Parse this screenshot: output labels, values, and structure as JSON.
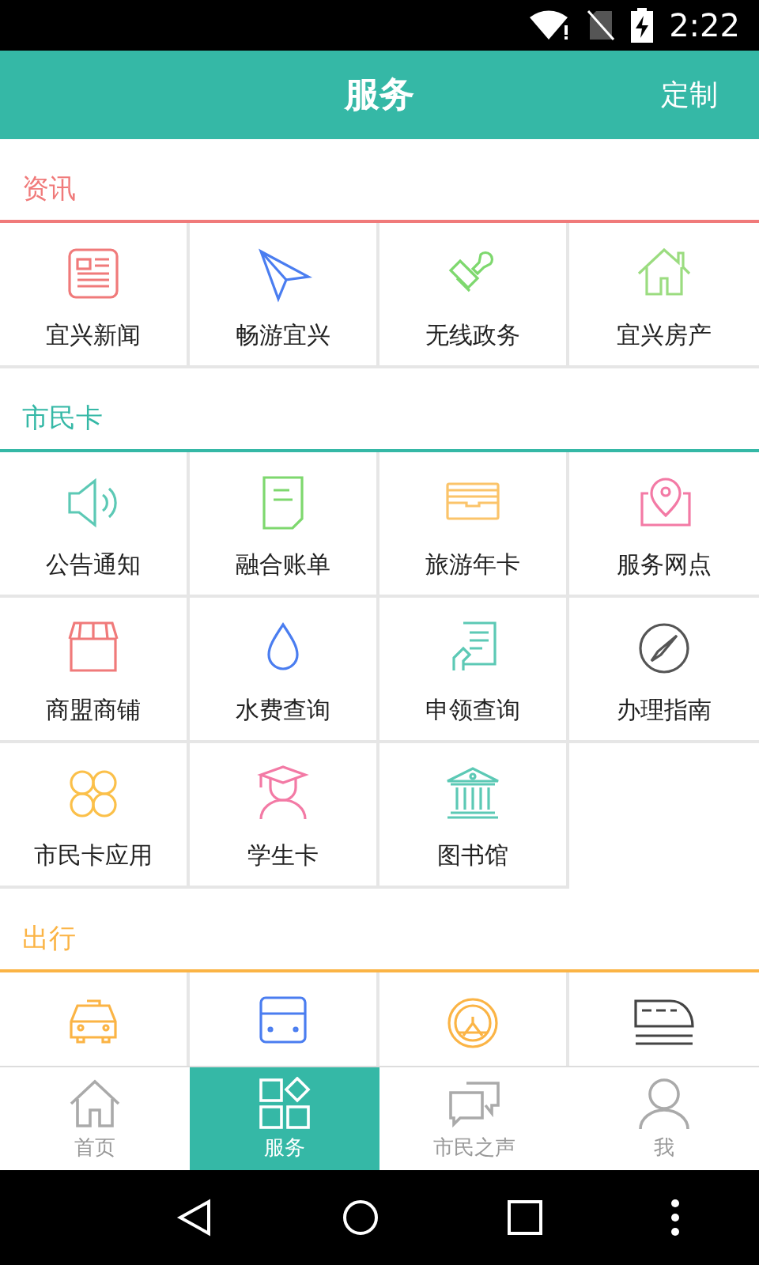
{
  "status_bar": {
    "time": "2:22"
  },
  "header": {
    "title": "服务",
    "action": "定制"
  },
  "sections": [
    {
      "title": "资讯",
      "color": "#f07a7a",
      "items": [
        {
          "kind": "news",
          "label": "宜兴新闻"
        },
        {
          "kind": "plane",
          "label": "畅游宜兴"
        },
        {
          "kind": "stamp",
          "label": "无线政务"
        },
        {
          "kind": "house",
          "label": "宜兴房产"
        }
      ]
    },
    {
      "title": "市民卡",
      "color": "#35b8a6",
      "items": [
        {
          "kind": "speaker",
          "label": "公告通知"
        },
        {
          "kind": "bill",
          "label": "融合账单"
        },
        {
          "kind": "tray",
          "label": "旅游年卡"
        },
        {
          "kind": "pin",
          "label": "服务网点"
        },
        {
          "kind": "shop",
          "label": "商盟商铺"
        },
        {
          "kind": "drop",
          "label": "水费查询"
        },
        {
          "kind": "form",
          "label": "申领查询"
        },
        {
          "kind": "compass",
          "label": "办理指南"
        },
        {
          "kind": "clover",
          "label": "市民卡应用"
        },
        {
          "kind": "student",
          "label": "学生卡"
        },
        {
          "kind": "library",
          "label": "图书馆"
        }
      ]
    },
    {
      "title": "出行",
      "color": "#fbb445",
      "items": [
        {
          "kind": "taxi"
        },
        {
          "kind": "bus"
        },
        {
          "kind": "wheel"
        },
        {
          "kind": "train"
        }
      ]
    }
  ],
  "tabs": [
    {
      "kind": "home",
      "label": "首页",
      "selected": false
    },
    {
      "kind": "services",
      "label": "服务",
      "selected": true
    },
    {
      "kind": "chat",
      "label": "市民之声",
      "selected": false
    },
    {
      "kind": "person",
      "label": "我",
      "selected": false
    }
  ]
}
